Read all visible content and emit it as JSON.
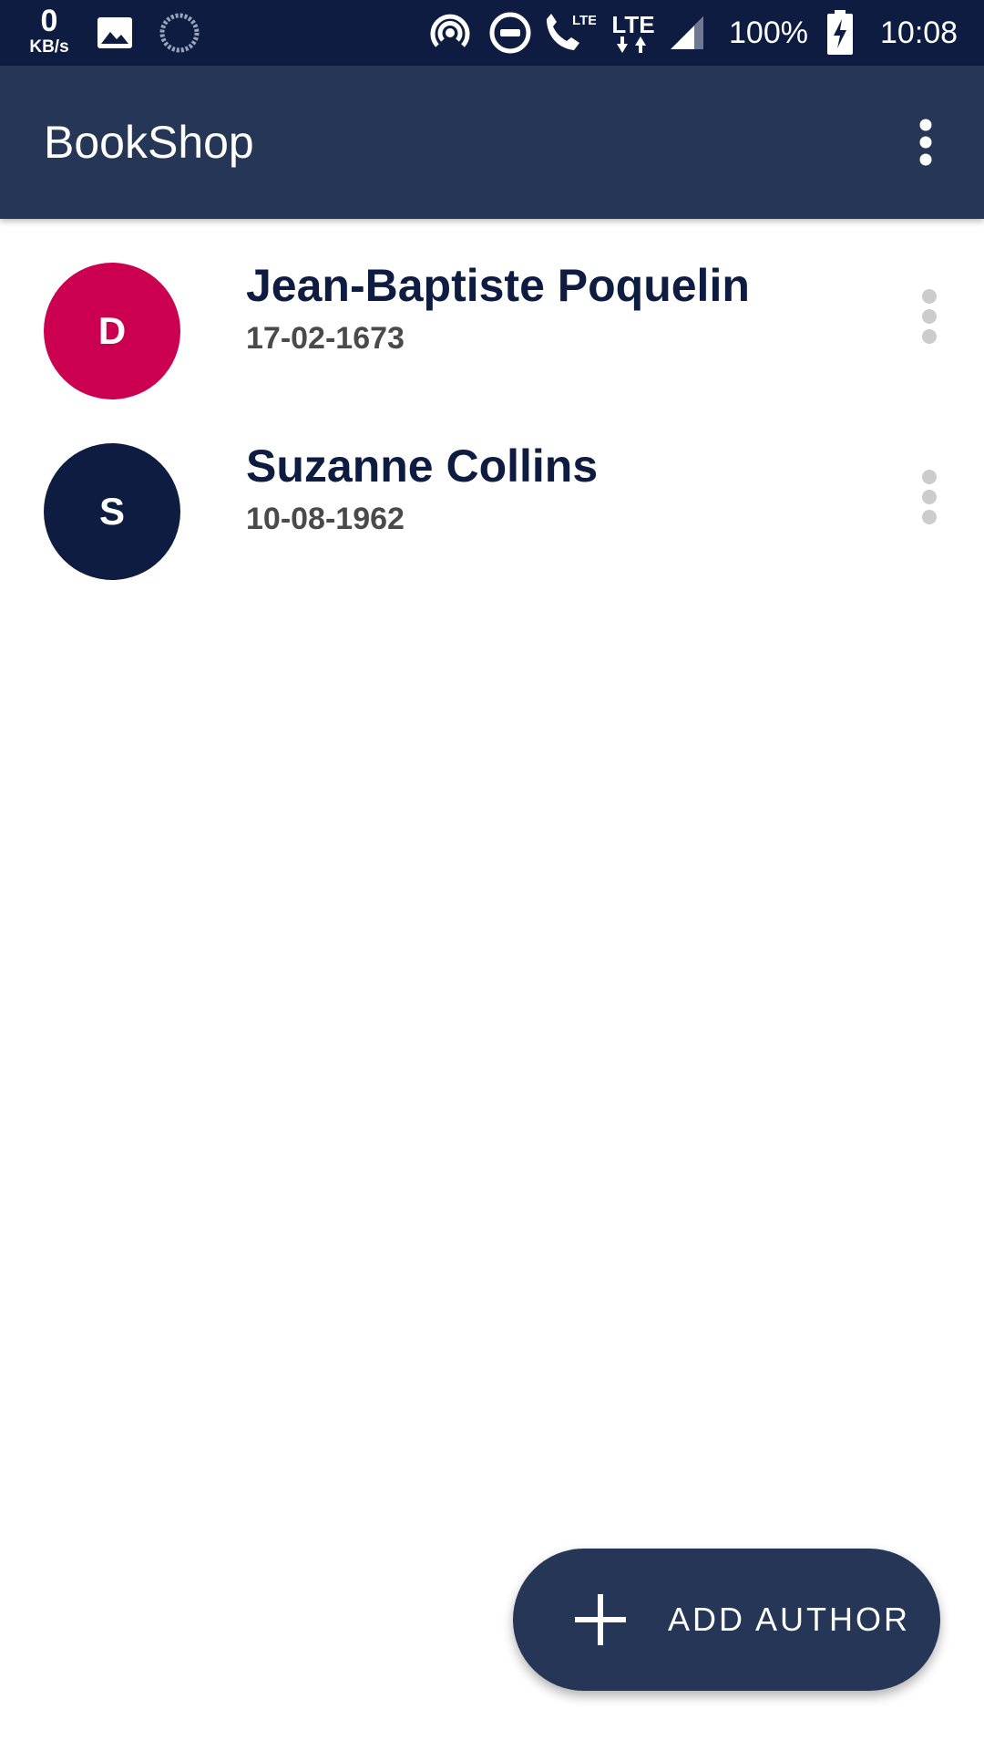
{
  "status_bar": {
    "net_speed_value": "0",
    "net_speed_unit": "KB/s",
    "battery_percent": "100%",
    "time": "10:08",
    "lte_label_1": "LTE",
    "lte_label_2": "LTE",
    "icons": [
      "image-icon",
      "sync-icon",
      "hotspot-icon",
      "do-not-disturb-icon",
      "volte-call-icon",
      "lte-data-icon",
      "signal-icon",
      "battery-charging-icon"
    ]
  },
  "app_bar": {
    "title": "BookShop",
    "overflow_icon": "more-vert-icon"
  },
  "authors": [
    {
      "initial": "D",
      "name": "Jean-Baptiste Poquelin",
      "date": "17-02-1673",
      "avatar_color": "#cc0050"
    },
    {
      "initial": "S",
      "name": "Suzanne Collins",
      "date": "10-08-1962",
      "avatar_color": "#0e1c42"
    }
  ],
  "fab": {
    "icon": "plus-icon",
    "label": "ADD AUTHOR"
  },
  "colors": {
    "status_bar": "#0e1c42",
    "app_bar": "#263657",
    "accent_pink": "#cc0050",
    "navy": "#0e1c42",
    "row_menu_dots": "#cccccc"
  }
}
